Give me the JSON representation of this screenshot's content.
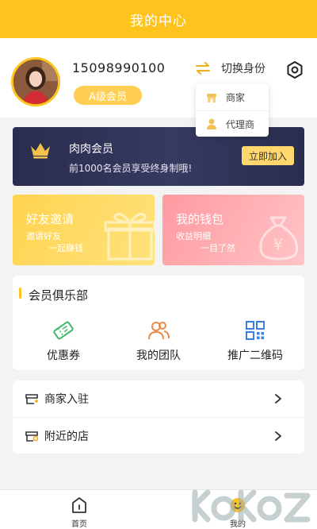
{
  "header": {
    "title": "我的中心"
  },
  "profile": {
    "phone": "15098990100",
    "level": "A级会员",
    "switch_label": "切换身份"
  },
  "identity_menu": {
    "items": [
      {
        "label": "商家",
        "icon": "store-icon"
      },
      {
        "label": "代理商",
        "icon": "agent-icon"
      }
    ]
  },
  "vip_banner": {
    "title": "肉肉会员",
    "subtitle": "前1000名会员享受终身制哦!",
    "join_label": "立即加入"
  },
  "cards": {
    "invite": {
      "title": "好友邀请",
      "sub1": "邀请好友",
      "sub2": "一起赚钱"
    },
    "wallet": {
      "title": "我的钱包",
      "sub1": "收益明细",
      "sub2": "一目了然"
    }
  },
  "club": {
    "title": "会员俱乐部",
    "items": [
      {
        "label": "优惠券",
        "icon": "coupon-icon",
        "color": "#3dba6b"
      },
      {
        "label": "我的团队",
        "icon": "team-icon",
        "color": "#e98a4a"
      },
      {
        "label": "推广二维码",
        "icon": "qrcode-icon",
        "color": "#3b7fe3"
      }
    ]
  },
  "list": {
    "items": [
      {
        "label": "商家入驻",
        "icon": "shop-enter-icon"
      },
      {
        "label": "附近的店",
        "icon": "nearby-store-icon"
      }
    ]
  },
  "tabbar": {
    "items": [
      {
        "label": "首页",
        "icon": "home-icon"
      },
      {
        "label": "我的",
        "icon": "mine-icon",
        "active": true
      }
    ]
  },
  "colors": {
    "accent": "#ffc31e",
    "vip_bg": "#2f3256",
    "invite": "#ffd34f",
    "wallet": "#ffa7ab"
  }
}
